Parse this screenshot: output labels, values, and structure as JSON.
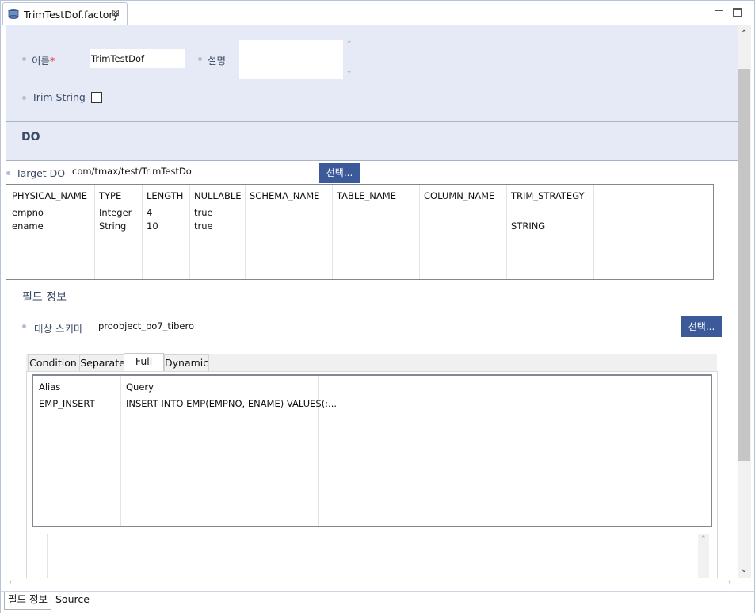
{
  "editor_tab": {
    "title": "TrimTestDof.factory",
    "close": "⊠",
    "icon": "factory-file-icon"
  },
  "form": {
    "name_label": "이름",
    "name_required": "*",
    "name_value": "TrimTestDof",
    "desc_label": "설명",
    "desc_value": "",
    "trim_label": "Trim String",
    "trim_checked": false
  },
  "do_section": {
    "heading": "DO",
    "target_label": "Target DO",
    "target_value": "com/tmax/test/TrimTestDo",
    "select_button": "선택...",
    "table": {
      "columns": [
        "PHYSICAL_NAME",
        "TYPE",
        "LENGTH",
        "NULLABLE",
        "SCHEMA_NAME",
        "TABLE_NAME",
        "COLUMN_NAME",
        "TRIM_STRATEGY"
      ],
      "rows": [
        [
          "empno",
          "Integer",
          "4",
          "true",
          "",
          "",
          "",
          ""
        ],
        [
          "ename",
          "String",
          "10",
          "true",
          "",
          "",
          "",
          "STRING"
        ]
      ]
    }
  },
  "field_info": {
    "heading": "필드 정보",
    "schema_label": "대상 스키마",
    "schema_value": "proobject_po7_tibero",
    "select_button": "선택..."
  },
  "query_tabs": {
    "tabs": [
      "Condition",
      "Separate",
      "Full",
      "Dynamic"
    ],
    "active": "Full",
    "table": {
      "columns": [
        "Alias",
        "Query"
      ],
      "rows": [
        [
          "EMP_INSERT",
          "INSERT INTO EMP(EMPNO, ENAME) VALUES(:..."
        ]
      ]
    }
  },
  "bottom_tabs": [
    "필드 정보",
    "Source"
  ],
  "scroll": {
    "up": "⌃",
    "down": "⌄",
    "left": "‹",
    "right": "›"
  }
}
